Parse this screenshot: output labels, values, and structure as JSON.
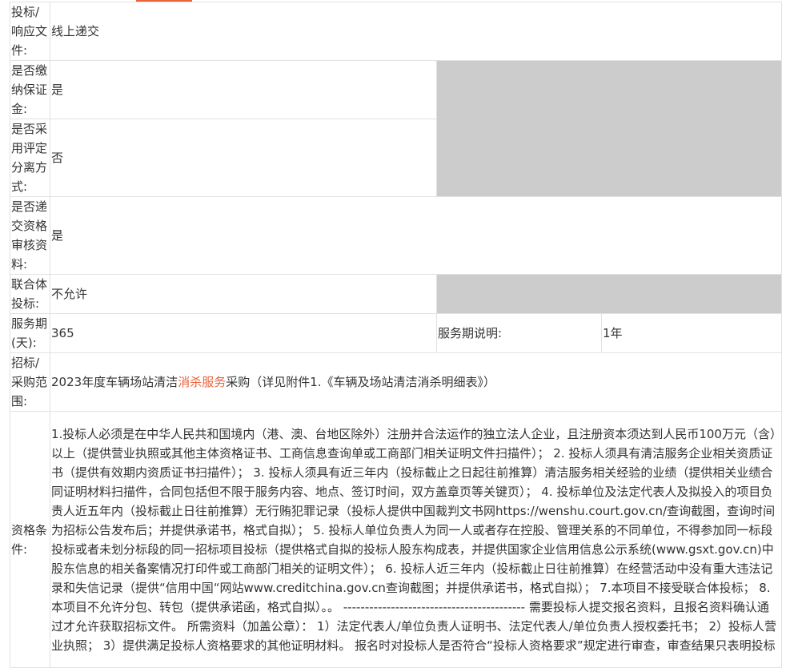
{
  "rows": {
    "submission": {
      "label": "投标/响应文件:",
      "value": "线上递交"
    },
    "deposit": {
      "label": "是否缴纳保证金:",
      "value": "是"
    },
    "separation": {
      "label": "是否采用评定分离方式:",
      "value": "否"
    },
    "qualification_docs": {
      "label": "是否递交资格审核资料:",
      "value": "是"
    },
    "consortium": {
      "label": "联合体投标:",
      "value": "不允许"
    },
    "service_period": {
      "label": "服务期(天):",
      "value": "365",
      "note_label": "服务期说明:",
      "note_value": "1年"
    },
    "scope": {
      "label": "招标/采购范围:",
      "prefix": "2023年度车辆场站清洁",
      "highlight": "消杀服务",
      "suffix": "采购（详见附件1.《车辆及场站清洁消杀明细表》）"
    },
    "requirements": {
      "label": "资格条件:",
      "text": "1.投标人必须是在中华人民共和国境内（港、澳、台地区除外）注册并合法运作的独立法人企业，且注册资本须达到人民币100万元（含）以上（提供营业执照或其他主体资格证书、工商信息查询单或工商部门相关证明文件扫描件）； 2. 投标人须具有清洁服务企业相关资质证书（提供有效期内资质证书扫描件）； 3. 投标人须具有近三年内（投标截止之日起往前推算）清洁服务相关经验的业绩（提供相关业绩合同证明材料扫描件，合同包括但不限于服务内容、地点、签订时间，双方盖章页等关键页）； 4. 投标单位及法定代表人及拟投入的项目负责人近五年内（投标截止日往前推算）无行贿犯罪记录（投标人提供中国裁判文书网https://wenshu.court.gov.cn/查询截图，查询时间为招标公告发布后；并提供承诺书，格式自拟）； 5. 投标人单位负责人为同一人或者存在控股、管理关系的不同单位，不得参加同一标段投标或者未划分标段的同一招标项目投标（提供格式自拟的投标人股东构成表，并提供国家企业信用信息公示系统(www.gsxt.gov.cn)中股东信息的相关备案情况打印件或工商部门相关的证明文件）； 6. 投标人近三年内（投标截止日往前推算）在经营活动中没有重大违法记录和失信记录（提供“信用中国“网站www.creditchina.gov.cn查询截图；并提供承诺书，格式自拟）； 7.本项目不接受联合体投标； 8.本项目不允许分包、转包（提供承诺函，格式自拟）。。 ------------------------------------------ 需要投标人提交报名资料，且报名资料确认通过才允许获取招标文件。 所需资料（加盖公章）： 1）法定代表人/单位负责人证明书、法定代表人/单位负责人授权委托书； 2）投标人营业执照； 3）提供满足投标人资格要求的其他证明材料。 报名时对投标人是否符合“投标人资格要求”规定进行审查，审查结果只表明投标"
    }
  },
  "colors": {
    "highlight": "#e8623a",
    "gray_cell": "#cccccc",
    "border": "#e2e2e2"
  }
}
